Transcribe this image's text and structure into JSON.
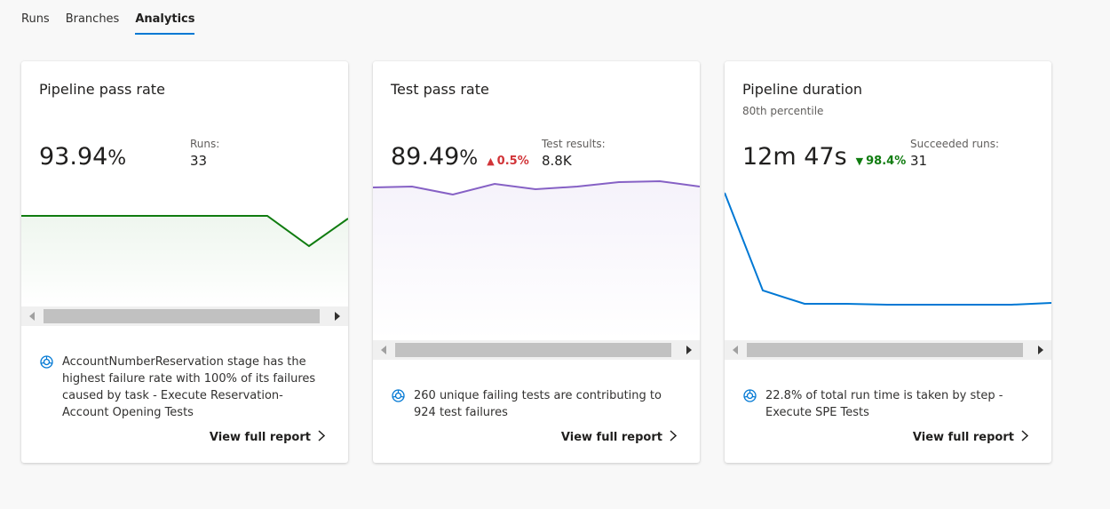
{
  "tabs": [
    {
      "label": "Runs"
    },
    {
      "label": "Branches"
    },
    {
      "label": "Analytics"
    }
  ],
  "cards": [
    {
      "title": "Pipeline pass rate",
      "metric_value": "93.94",
      "metric_unit": "%",
      "side_label": "Runs:",
      "side_value": "33",
      "insight": "AccountNumberReservation stage has the highest failure rate with 100% of its failures caused by task - Execute Reservation-Account Opening Tests",
      "link": "View full report",
      "line_color": "#107c10",
      "icons": {
        "insight": "insight-icon",
        "scroll_left": "caret-left-icon",
        "scroll_right": "caret-right-icon",
        "link": "chevron-right-icon"
      }
    },
    {
      "title": "Test pass rate",
      "metric_value": "89.49",
      "metric_unit": "%",
      "delta": "0.5%",
      "delta_direction": "up",
      "side_label": "Test results:",
      "side_value": "8.8K",
      "insight": "260 unique failing tests are contributing to 924 test failures",
      "link": "View full report",
      "line_color": "#8661c5"
    },
    {
      "title": "Pipeline duration",
      "subtitle": "80th percentile",
      "metric_value": "12m 47s",
      "delta": "98.4%",
      "delta_direction": "down",
      "side_label": "Succeeded runs:",
      "side_value": "31",
      "insight": "22.8% of total run time is taken by step - Execute SPE Tests",
      "link": "View full report",
      "line_color": "#0078d4"
    }
  ],
  "colors": {
    "accent": "#0078d4",
    "delta_up": "#d13438",
    "delta_down": "#107c10"
  }
}
